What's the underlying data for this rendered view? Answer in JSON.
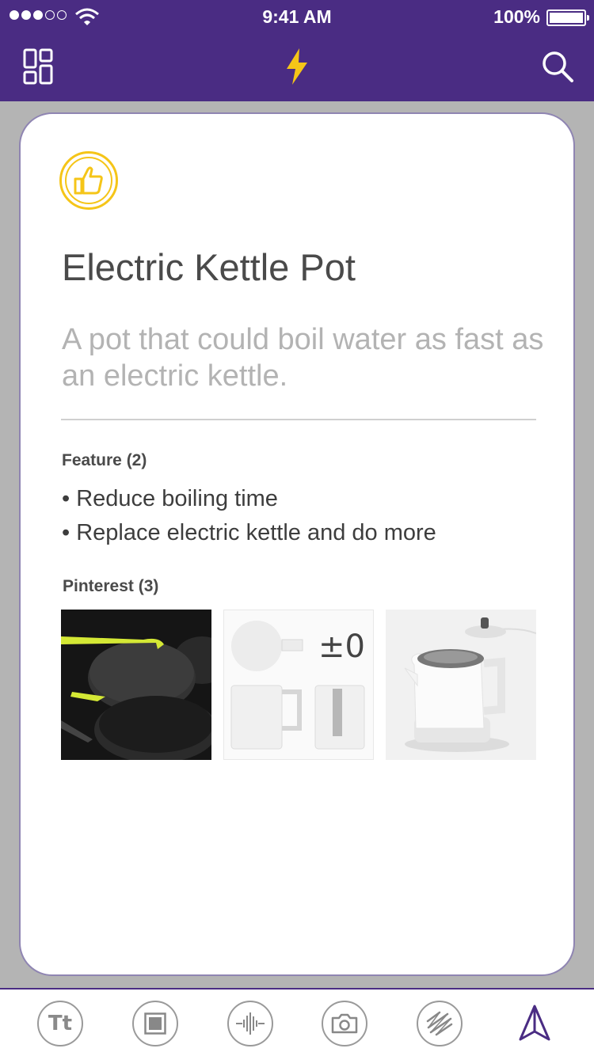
{
  "status_bar": {
    "signal_bars_filled": 3,
    "signal_bars_total": 5,
    "time": "9:41 AM",
    "battery": "100%"
  },
  "nav": {
    "left_icon": "board-layout-icon",
    "center_icon": "lightning-bolt-icon",
    "right_icon": "search-icon",
    "accent": "#f5c518",
    "bar_color": "#4a2c83"
  },
  "card": {
    "badge_icon": "thumbs-up-icon",
    "title": "Electric Kettle Pot",
    "subtitle": "A pot that could boil water as fast as an electric kettle.",
    "features": {
      "heading": "Feature (2)",
      "items": [
        "Reduce boiling time",
        "Replace electric kettle and do more"
      ]
    },
    "pinterest": {
      "heading": "Pinterest (3)",
      "images": [
        {
          "name": "black-pans-image"
        },
        {
          "name": "white-jugs-image",
          "text": "±0"
        },
        {
          "name": "white-kettle-image"
        }
      ]
    }
  },
  "toolbar": {
    "tools": [
      {
        "name": "text-tool-icon",
        "glyph": "Tt"
      },
      {
        "name": "frame-tool-icon"
      },
      {
        "name": "audio-tool-icon"
      },
      {
        "name": "camera-tool-icon"
      },
      {
        "name": "sketch-tool-icon"
      },
      {
        "name": "send-icon"
      }
    ]
  }
}
